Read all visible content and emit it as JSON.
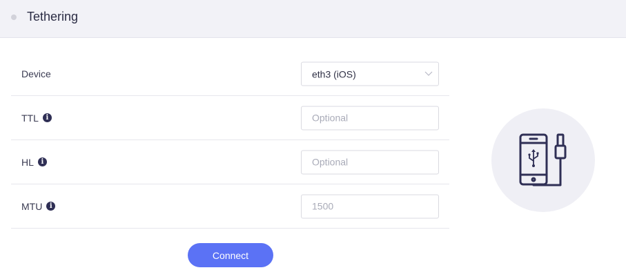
{
  "header": {
    "title": "Tethering"
  },
  "form": {
    "device": {
      "label": "Device",
      "value": "eth3 (iOS)"
    },
    "ttl": {
      "label": "TTL",
      "placeholder": "Optional"
    },
    "hl": {
      "label": "HL",
      "placeholder": "Optional"
    },
    "mtu": {
      "label": "MTU",
      "placeholder": "1500"
    }
  },
  "actions": {
    "connect_label": "Connect"
  },
  "colors": {
    "accent": "#5b72f5",
    "header_bg": "#f2f2f7",
    "icon_dark": "#2f2f55"
  },
  "icons": {
    "info": "info-icon",
    "chevron": "chevron-down-icon",
    "illustration": "phone-usb-icon"
  }
}
